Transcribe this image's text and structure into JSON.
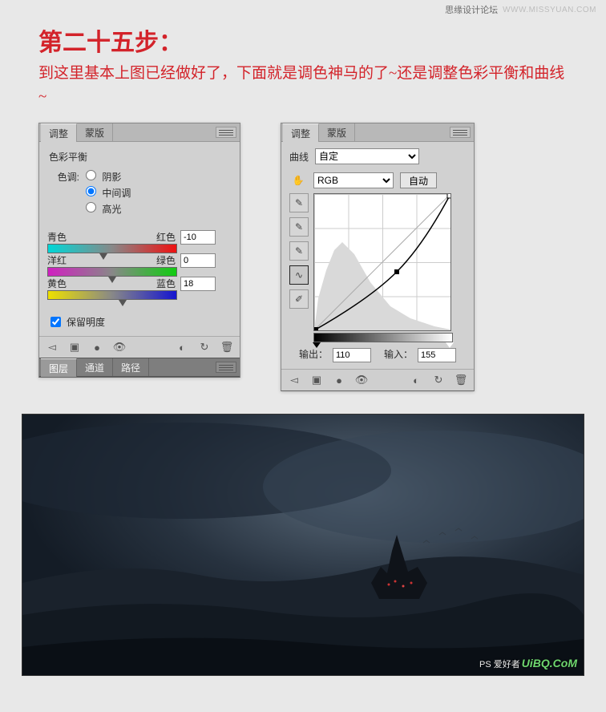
{
  "credit": {
    "name": "思缘设计论坛",
    "site": "WWW.MISSYUAN.COM"
  },
  "step": {
    "title": "第二十五步：",
    "desc": "到这里基本上图已经做好了，下面就是调色神马的了~还是调整色彩平衡和曲线~"
  },
  "left_panel": {
    "tabs": {
      "adjust": "调整",
      "mask": "蒙版"
    },
    "subtitle": "色彩平衡",
    "tone_label": "色调:",
    "tone_options": {
      "shadow": "阴影",
      "mid": "中间调",
      "high": "高光"
    },
    "tone_selected": "mid",
    "sliders": [
      {
        "left": "青色",
        "right": "红色",
        "value": "-10",
        "pos": 43
      },
      {
        "left": "洋红",
        "right": "绿色",
        "value": "0",
        "pos": 50
      },
      {
        "left": "黄色",
        "right": "蓝色",
        "value": "18",
        "pos": 58
      }
    ],
    "preserve_lum": "保留明度",
    "lower_tabs": {
      "layers": "图层",
      "channels": "通道",
      "paths": "路径"
    }
  },
  "right_panel": {
    "tabs": {
      "adjust": "调整",
      "mask": "蒙版"
    },
    "type_label": "曲线",
    "type_value": "自定",
    "channel_value": "RGB",
    "auto_label": "自动",
    "output_label": "输出：",
    "output_value": "110",
    "input_label": "输入：",
    "input_value": "155"
  },
  "watermark": {
    "text": "UiBQ.CoM",
    "sub": "PS 爱好者"
  },
  "chart_data": {
    "type": "line",
    "title": "Curves",
    "xlabel": "Input",
    "ylabel": "Output",
    "x": [
      0,
      155,
      255
    ],
    "values": [
      0,
      110,
      255
    ],
    "xlim": [
      0,
      255
    ],
    "ylim": [
      0,
      255
    ]
  }
}
